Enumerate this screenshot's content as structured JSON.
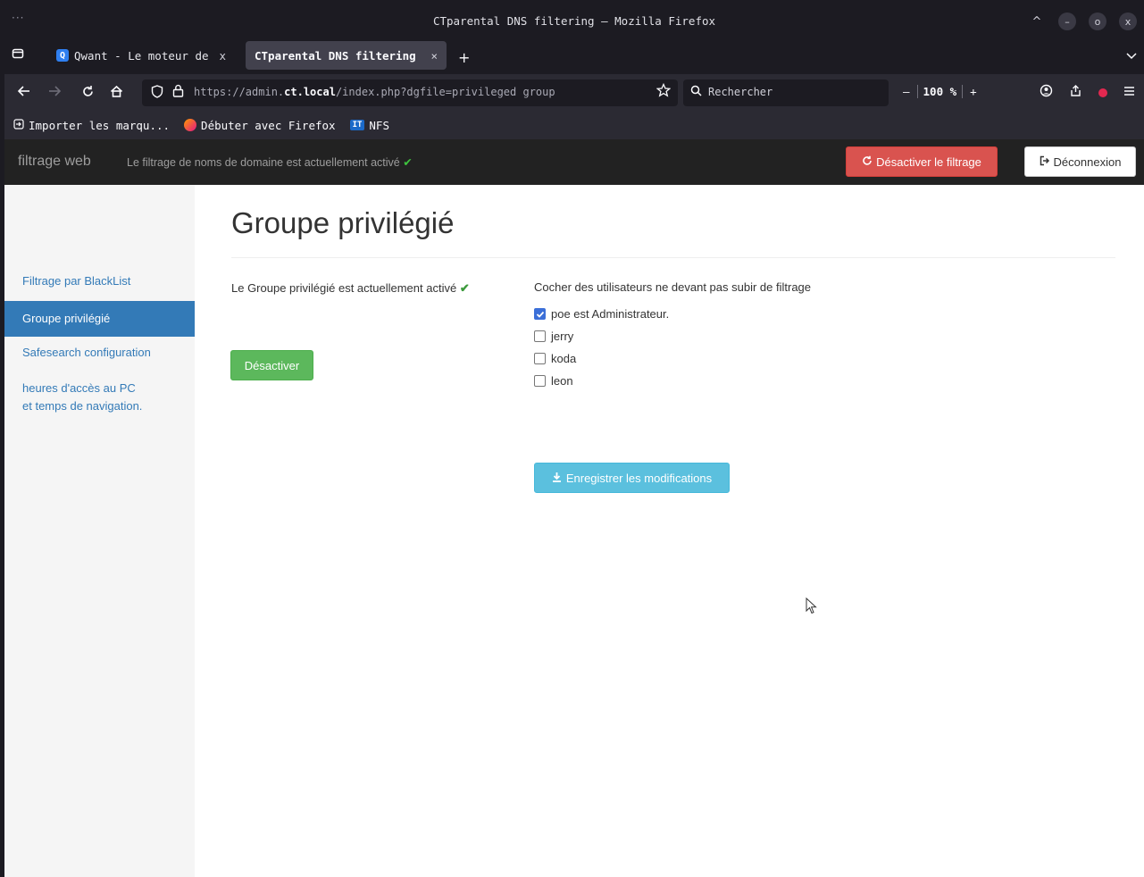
{
  "window": {
    "title": "CTparental DNS filtering — Mozilla Firefox",
    "menu_glyph": "···",
    "controls": {
      "up": "^",
      "minimize": "–",
      "maximize": "o",
      "close": "x"
    }
  },
  "tabs": [
    {
      "label": "Qwant - Le moteur de re",
      "close": "x",
      "favicon": "Q",
      "active": false
    },
    {
      "label": "CTparental DNS filtering",
      "close": "×",
      "active": true
    }
  ],
  "new_tab": "+",
  "navbar": {
    "url_prefix": "https://admin.",
    "url_host": "ct.local",
    "url_path": "/index.php?dgfile=privileged group",
    "search_placeholder": "Rechercher",
    "zoom_minus": "—",
    "zoom_value": "100 %",
    "zoom_plus": "+"
  },
  "bookmarks": [
    {
      "label": "Importer les marqu..."
    },
    {
      "label": "Débuter avec Firefox"
    },
    {
      "label": "NFS",
      "badge": "IT"
    }
  ],
  "app": {
    "brand": "filtrage web",
    "status_text": "Le filtrage de noms de domaine est actuellement activé",
    "status_check": "✔",
    "disable_filter_label": "Désactiver le filtrage",
    "logout_label": "Déconnexion"
  },
  "sidebar": {
    "items": [
      {
        "label": "Filtrage par BlackList",
        "active": false
      },
      {
        "label": "Groupe privilégié",
        "active": true
      },
      {
        "label": "Safesearch configuration",
        "active": false
      },
      {
        "label": "heures d'accès au PC et temps de navigation.",
        "active": false
      }
    ]
  },
  "main": {
    "title": "Groupe privilégié",
    "group_status": "Le Groupe privilégié est actuellement activé",
    "group_check": "✔",
    "deactivate_label": "Désactiver",
    "users_title": "Cocher des utilisateurs ne devant pas subir de filtrage",
    "users": [
      {
        "label": "poe est Administrateur.",
        "checked": true
      },
      {
        "label": "jerry",
        "checked": false
      },
      {
        "label": "koda",
        "checked": false
      },
      {
        "label": "leon",
        "checked": false
      }
    ],
    "save_label": "Enregistrer les modifications"
  },
  "colors": {
    "navbar_bg": "#222222",
    "sidebar_active": "#337ab7",
    "danger": "#d9534f",
    "success": "#5cb85c",
    "info": "#5bc0de"
  }
}
